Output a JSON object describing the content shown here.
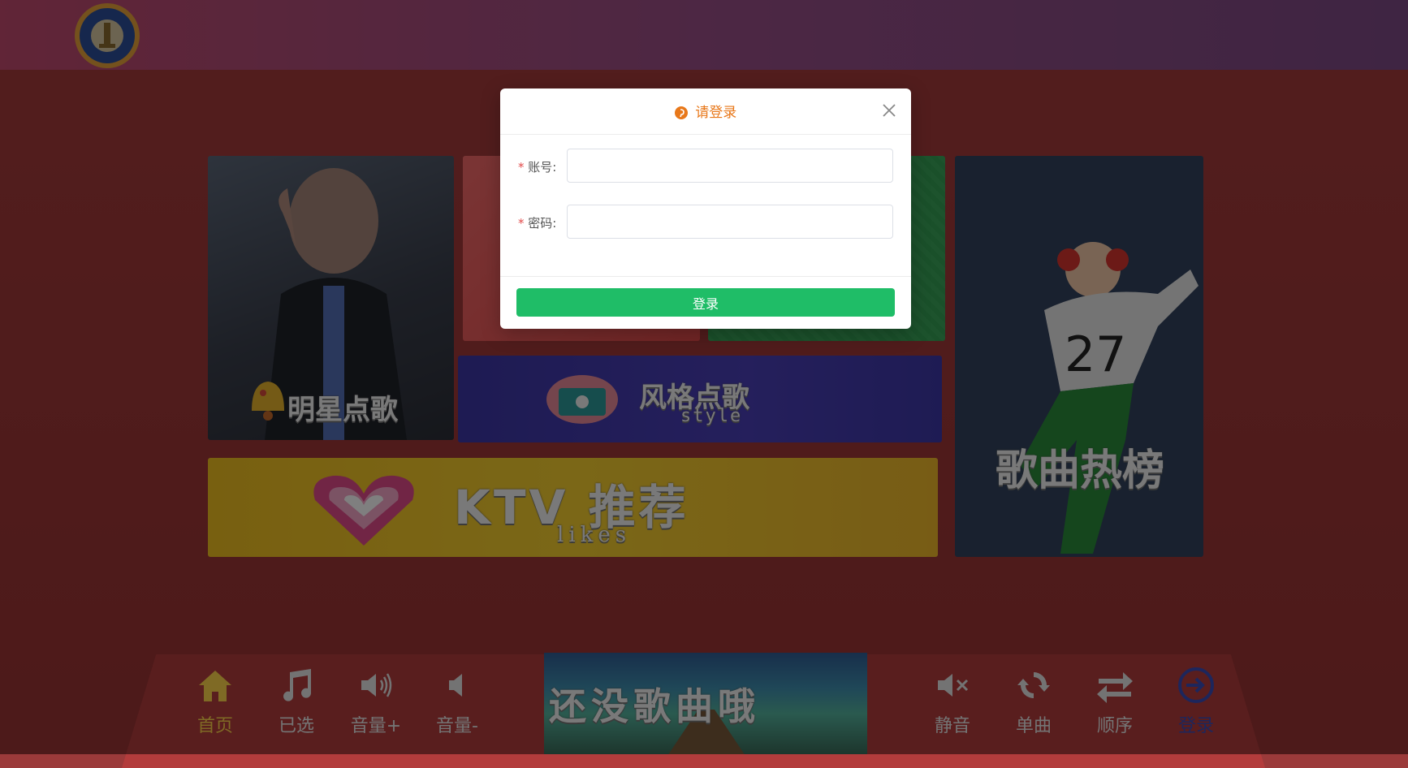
{
  "logo": {
    "text_top": "TRUTH",
    "text_left": "FREEDOM",
    "text_right": "JUSTICE",
    "text_bottom_left": "LOVE",
    "text_bottom_right": "PEACE"
  },
  "tiles": {
    "star": {
      "label": "明星点歌"
    },
    "style": {
      "label": "风格点歌",
      "sub": "style"
    },
    "hot": {
      "label": "歌曲热榜"
    },
    "ktv": {
      "label": "KTV 推荐",
      "sub": "likes"
    }
  },
  "now_playing": {
    "label": "还没歌曲哦"
  },
  "controls": {
    "home": "首页",
    "selected": "已选",
    "volume_up": "音量+",
    "volume_down": "音量-",
    "mute": "静音",
    "single": "单曲",
    "order": "顺序",
    "login": "登录"
  },
  "modal": {
    "title": "请登录",
    "account_label": "账号:",
    "account_value": "",
    "password_label": "密码:",
    "password_value": "",
    "required_mark": "*",
    "submit": "登录"
  },
  "colors": {
    "title_accent": "#e8781a",
    "submit_bg": "#1fbd67",
    "required": "#e24b4b",
    "home_active": "#ffd44a",
    "login_icon": "#3a4db8"
  }
}
